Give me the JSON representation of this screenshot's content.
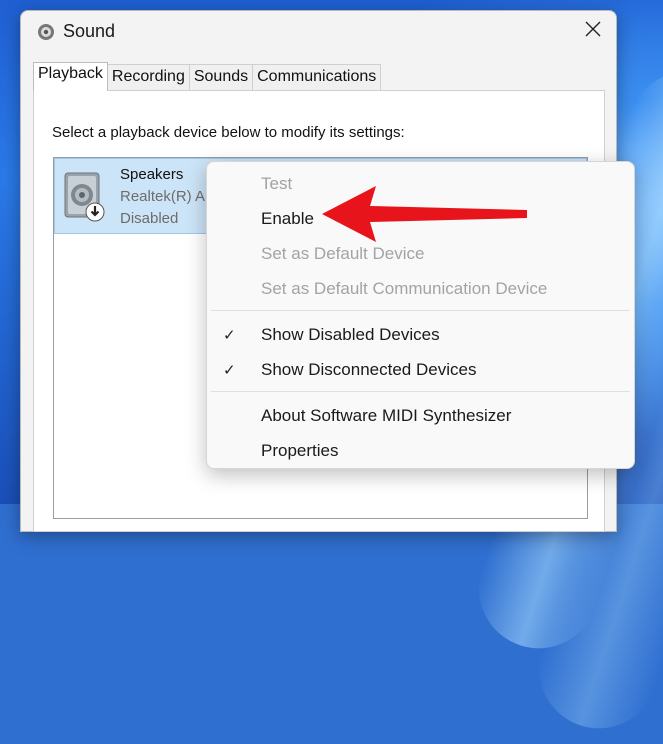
{
  "window": {
    "title": "Sound",
    "close_icon": "close-icon",
    "app_icon": "speaker-icon"
  },
  "tabs": [
    {
      "label": "Playback",
      "active": true
    },
    {
      "label": "Recording",
      "active": false
    },
    {
      "label": "Sounds",
      "active": false
    },
    {
      "label": "Communications",
      "active": false
    }
  ],
  "instruction": "Select a playback device below to modify its settings:",
  "device": {
    "name": "Speakers",
    "driver": "Realtek(R) Au",
    "status": "Disabled",
    "icon": "speaker-device-icon",
    "badge_icon": "disabled-arrow-icon"
  },
  "context_menu": {
    "items": [
      {
        "label": "Test",
        "disabled": true,
        "checked": false
      },
      {
        "label": "Enable",
        "disabled": false,
        "checked": false
      },
      {
        "label": "Set as Default Device",
        "disabled": true,
        "checked": false
      },
      {
        "label": "Set as Default Communication Device",
        "disabled": true,
        "checked": false
      },
      {
        "label": "Show Disabled Devices",
        "disabled": false,
        "checked": true
      },
      {
        "label": "Show Disconnected Devices",
        "disabled": false,
        "checked": true
      },
      {
        "label": "About Software MIDI Synthesizer",
        "disabled": false,
        "checked": false
      },
      {
        "label": "Properties",
        "disabled": false,
        "checked": false
      }
    ],
    "check_glyph": "✓"
  },
  "annotation": {
    "arrow_color": "#e8141b",
    "points_to": "Enable"
  },
  "colors": {
    "selection": "#cce4f7",
    "disabled_text": "#a3a3a3"
  }
}
